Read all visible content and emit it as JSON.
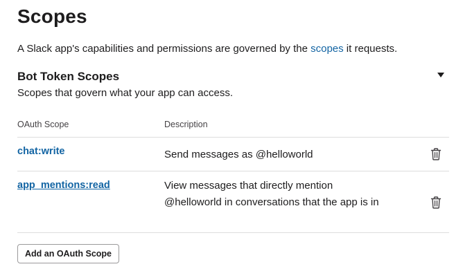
{
  "page": {
    "title": "Scopes",
    "intro_prefix": "A Slack app's capabilities and permissions are governed by the ",
    "intro_link": "scopes",
    "intro_suffix": " it requests."
  },
  "section": {
    "title": "Bot Token Scopes",
    "description": "Scopes that govern what your app can access.",
    "expand_icon": "caret-down-icon"
  },
  "table": {
    "headers": {
      "scope": "OAuth Scope",
      "description": "Description"
    },
    "rows": [
      {
        "scope": "chat:write",
        "description": "Send messages as @helloworld",
        "action_icon": "trash-icon"
      },
      {
        "scope": "app_mentions:read",
        "description": "View messages that directly mention @helloworld in conversations that the app is in",
        "action_icon": "trash-icon"
      }
    ]
  },
  "actions": {
    "add_scope_label": "Add an OAuth Scope"
  },
  "colors": {
    "link": "#1264a3",
    "text": "#1d1c1d",
    "divider": "#dddddd"
  }
}
